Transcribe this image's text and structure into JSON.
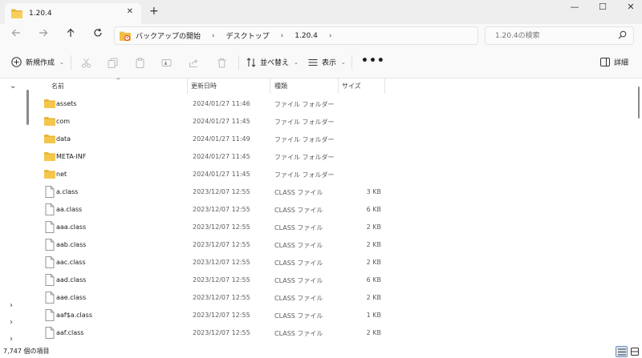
{
  "tab": {
    "title": "1.20.4",
    "close": "✕",
    "new_tab": "+"
  },
  "window": {
    "minimize": "—",
    "maximize": "☐",
    "close": "✕"
  },
  "nav": {
    "breadcrumbs": [
      "バックアップの開始",
      "デスクトップ",
      "1.20.4"
    ],
    "separator": "›",
    "search_placeholder": "1.20.4の検索"
  },
  "commands": {
    "new": "新規作成",
    "sort": "並べ替え",
    "view": "表示",
    "more": "•••",
    "details": "詳細"
  },
  "columns": {
    "name": "名前",
    "date": "更新日時",
    "type": "種類",
    "size": "サイズ"
  },
  "files": [
    {
      "name": "assets",
      "date": "2024/01/27 11:46",
      "type": "ファイル フォルダー",
      "size": "",
      "kind": "folder"
    },
    {
      "name": "com",
      "date": "2024/01/27 11:45",
      "type": "ファイル フォルダー",
      "size": "",
      "kind": "folder"
    },
    {
      "name": "data",
      "date": "2024/01/27 11:49",
      "type": "ファイル フォルダー",
      "size": "",
      "kind": "folder"
    },
    {
      "name": "META-INF",
      "date": "2024/01/27 11:45",
      "type": "ファイル フォルダー",
      "size": "",
      "kind": "folder"
    },
    {
      "name": "net",
      "date": "2024/01/27 11:45",
      "type": "ファイル フォルダー",
      "size": "",
      "kind": "folder"
    },
    {
      "name": "a.class",
      "date": "2023/12/07 12:55",
      "type": "CLASS ファイル",
      "size": "3 KB",
      "kind": "file"
    },
    {
      "name": "aa.class",
      "date": "2023/12/07 12:55",
      "type": "CLASS ファイル",
      "size": "6 KB",
      "kind": "file"
    },
    {
      "name": "aaa.class",
      "date": "2023/12/07 12:55",
      "type": "CLASS ファイル",
      "size": "2 KB",
      "kind": "file"
    },
    {
      "name": "aab.class",
      "date": "2023/12/07 12:55",
      "type": "CLASS ファイル",
      "size": "2 KB",
      "kind": "file"
    },
    {
      "name": "aac.class",
      "date": "2023/12/07 12:55",
      "type": "CLASS ファイル",
      "size": "2 KB",
      "kind": "file"
    },
    {
      "name": "aad.class",
      "date": "2023/12/07 12:55",
      "type": "CLASS ファイル",
      "size": "6 KB",
      "kind": "file"
    },
    {
      "name": "aae.class",
      "date": "2023/12/07 12:55",
      "type": "CLASS ファイル",
      "size": "2 KB",
      "kind": "file"
    },
    {
      "name": "aaf$a.class",
      "date": "2023/12/07 12:55",
      "type": "CLASS ファイル",
      "size": "1 KB",
      "kind": "file"
    },
    {
      "name": "aaf.class",
      "date": "2023/12/07 12:55",
      "type": "CLASS ファイル",
      "size": "2 KB",
      "kind": "file"
    }
  ],
  "status": {
    "item_count": "7,747 個の項目"
  },
  "icons": {
    "folder": "folder-icon",
    "file": "file-icon",
    "back": "arrow-left-icon",
    "forward": "arrow-right-icon",
    "up": "arrow-up-icon",
    "refresh": "refresh-icon",
    "search": "search-icon"
  },
  "colors": {
    "folder": "#f4c64c",
    "accent": "#1f6fd1"
  }
}
